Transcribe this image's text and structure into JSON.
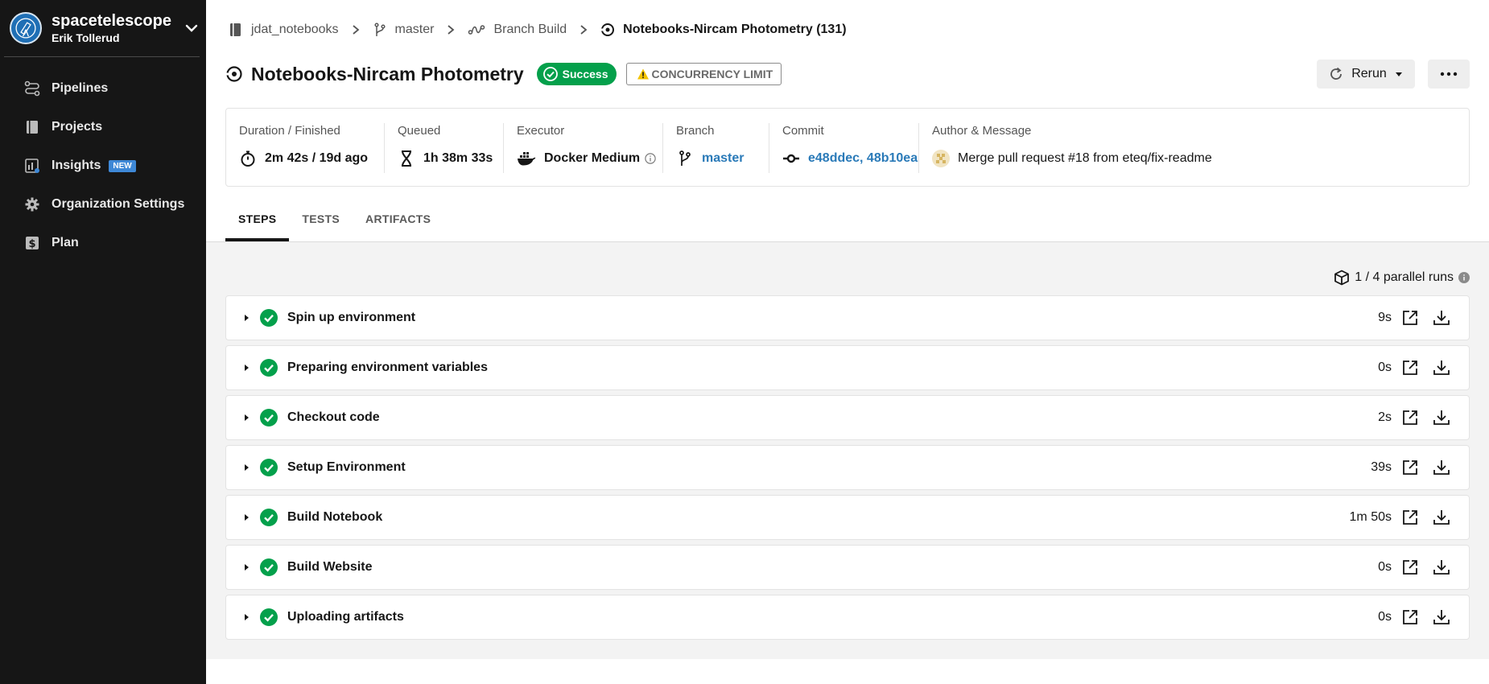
{
  "org": {
    "name": "spacetelescope",
    "user": "Erik Tollerud"
  },
  "nav": {
    "items": [
      {
        "label": "Pipelines"
      },
      {
        "label": "Projects"
      },
      {
        "label": "Insights",
        "badge": "NEW"
      },
      {
        "label": "Organization Settings"
      },
      {
        "label": "Plan"
      }
    ]
  },
  "breadcrumb": {
    "project": "jdat_notebooks",
    "branch": "master",
    "pipeline": "Branch Build",
    "job": "Notebooks-Nircam Photometry (131)"
  },
  "header": {
    "title": "Notebooks-Nircam Photometry",
    "status": "Success",
    "warning": "CONCURRENCY LIMIT",
    "rerun_label": "Rerun",
    "more_label": "•••"
  },
  "info": {
    "duration": {
      "label": "Duration / Finished",
      "value": "2m 42s / 19d ago"
    },
    "queued": {
      "label": "Queued",
      "value": "1h 38m 33s"
    },
    "executor": {
      "label": "Executor",
      "value": "Docker Medium"
    },
    "branch": {
      "label": "Branch",
      "value": "master"
    },
    "commit": {
      "label": "Commit",
      "value": "e48ddec, 48b10ea"
    },
    "author": {
      "label": "Author & Message",
      "value": "Merge pull request #18 from eteq/fix-readme"
    }
  },
  "tabs": [
    {
      "label": "STEPS",
      "active": true
    },
    {
      "label": "TESTS"
    },
    {
      "label": "ARTIFACTS"
    }
  ],
  "parallel": {
    "label": "1 / 4 parallel runs"
  },
  "steps": [
    {
      "name": "Spin up environment",
      "duration": "9s"
    },
    {
      "name": "Preparing environment variables",
      "duration": "0s"
    },
    {
      "name": "Checkout code",
      "duration": "2s"
    },
    {
      "name": "Setup Environment",
      "duration": "39s"
    },
    {
      "name": "Build Notebook",
      "duration": "1m 50s"
    },
    {
      "name": "Build Website",
      "duration": "0s"
    },
    {
      "name": "Uploading artifacts",
      "duration": "0s"
    }
  ],
  "colors": {
    "sidebar": "#161616",
    "success": "#04a04b",
    "link": "#2a7ab8",
    "badge": "#3e88d6"
  }
}
